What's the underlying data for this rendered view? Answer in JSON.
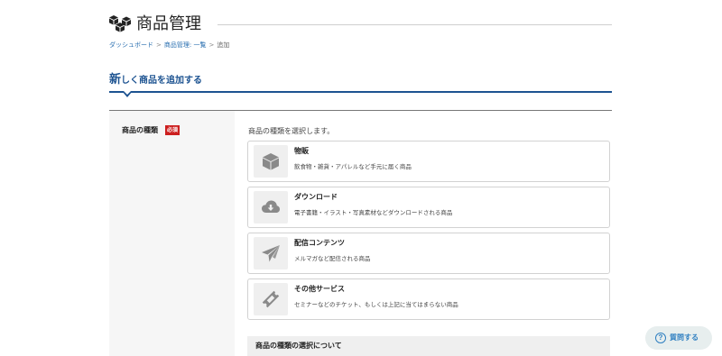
{
  "page": {
    "title": "商品管理",
    "logo_icon": "boxes-icon"
  },
  "breadcrumb": {
    "items": [
      "ダッシュボード",
      "商品管理: 一覧",
      "追加"
    ],
    "separator": ">"
  },
  "section": {
    "heading_first_char": "新",
    "heading_rest": "しく商品を追加する"
  },
  "form": {
    "field_label": "商品の種類",
    "required_badge": "必須",
    "instruction": "商品の種類を選択します。",
    "options": [
      {
        "title": "物販",
        "description": "飲食物・雑貨・アパレルなど手元に届く商品",
        "icon": "box-icon"
      },
      {
        "title": "ダウンロード",
        "description": "電子書籍・イラスト・写真素材などダウンロードされる商品",
        "icon": "cloud-download-icon"
      },
      {
        "title": "配信コンテンツ",
        "description": "メルマガなど配信される商品",
        "icon": "paper-plane-icon"
      },
      {
        "title": "その他サービス",
        "description": "セミナーなどのチケット、もしくは上記に当てはまらない商品",
        "icon": "ticket-icon"
      }
    ],
    "about_title": "商品の種類の選択について"
  },
  "help": {
    "label": "質問する",
    "icon_glyph": "?"
  },
  "colors": {
    "accent": "#1d5391",
    "link": "#2a6fb0",
    "required": "#cc1f1f",
    "help": "#2f7fc1"
  }
}
